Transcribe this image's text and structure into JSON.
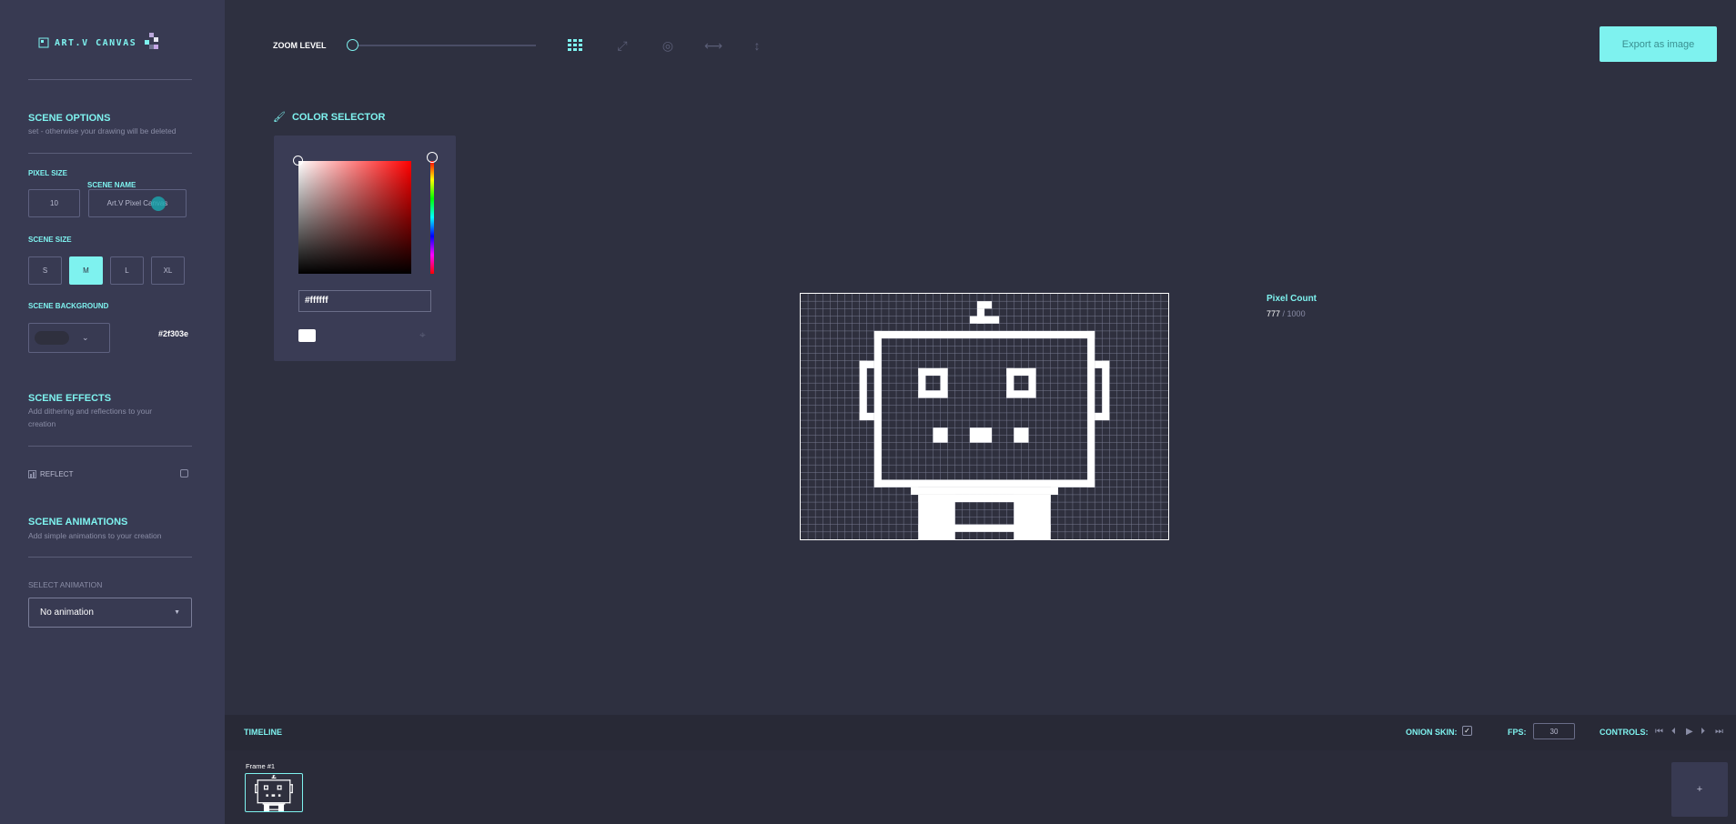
{
  "app": {
    "logo_text": "ART.V CANVAS"
  },
  "sidebar": {
    "scene_options": {
      "title": "SCENE OPTIONS",
      "subtitle": "set - otherwise your drawing will be deleted"
    },
    "pixel_size": {
      "label": "PIXEL SIZE",
      "value": "10"
    },
    "scene_name": {
      "label": "SCENE NAME",
      "value": "Art.V Pixel Canvas"
    },
    "scene_size": {
      "label": "SCENE SIZE",
      "options": [
        "S",
        "M",
        "L",
        "XL"
      ],
      "selected": "M"
    },
    "scene_background": {
      "label": "SCENE BACKGROUND",
      "value": "#2f303e"
    },
    "scene_effects": {
      "title": "SCENE EFFECTS",
      "subtitle": "Add dithering and reflections to your creation",
      "reflect_label": "REFLECT"
    },
    "scene_animations": {
      "title": "SCENE ANIMATIONS",
      "subtitle": "Add simple animations to your creation",
      "select_label": "SELECT ANIMATION",
      "selected": "No animation"
    }
  },
  "toolbar": {
    "zoom_label": "ZOOM LEVEL",
    "export_label": "Export as image"
  },
  "color_selector": {
    "title": "COLOR SELECTOR",
    "hex_value": "#ffffff",
    "current_color": "#ffffff"
  },
  "pixel_count": {
    "label": "Pixel Count",
    "value": "777",
    "max": "/ 1000"
  },
  "canvas": {
    "background": "#2f303e",
    "grid_cols": 50,
    "grid_rows": 33
  },
  "timeline": {
    "title": "TIMELINE",
    "onion_label": "ONION SKIN:",
    "fps_label": "FPS:",
    "fps_value": "30",
    "controls_label": "CONTROLS:",
    "frames": [
      {
        "label": "Frame #1"
      }
    ],
    "add_label": "+"
  },
  "colors": {
    "accent": "#7ef2ef",
    "sidebar": "#383a52",
    "bg": "#2e3040"
  }
}
